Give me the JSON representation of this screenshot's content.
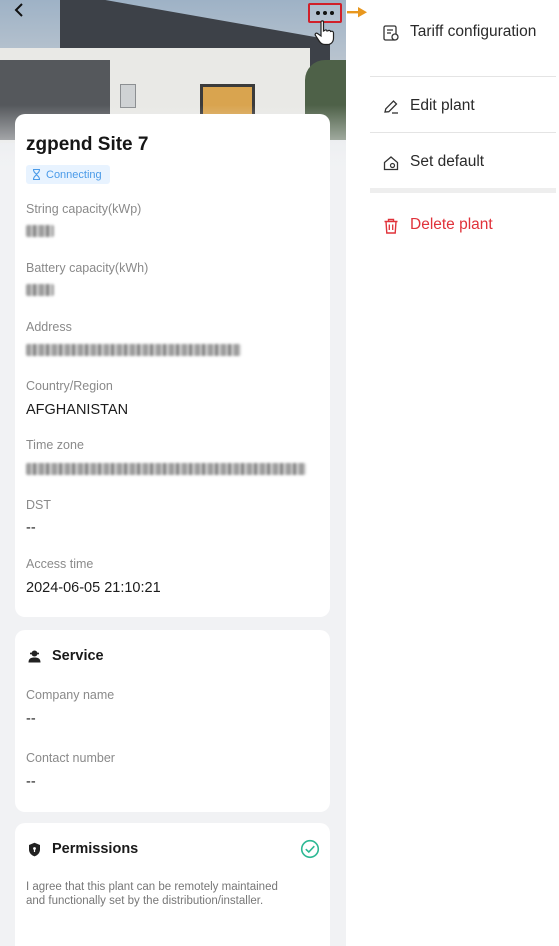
{
  "header": {
    "back_icon": "chevron-left-icon",
    "more_icon": "more-horizontal-icon"
  },
  "plant": {
    "name": "zgpend Site 7",
    "status": "Connecting",
    "fields": [
      {
        "label": "String capacity(kWp)",
        "value": ""
      },
      {
        "label": "Battery capacity(kWh)",
        "value": ""
      },
      {
        "label": "Address",
        "value": ""
      },
      {
        "label": "Country/Region",
        "value": "AFGHANISTAN"
      },
      {
        "label": "Time zone",
        "value": ""
      },
      {
        "label": "DST",
        "value": "--"
      },
      {
        "label": "Access time",
        "value": "2024-06-05 21:10:21"
      }
    ]
  },
  "service": {
    "title": "Service",
    "fields": [
      {
        "label": "Company name",
        "value": "--"
      },
      {
        "label": "Contact number",
        "value": "--"
      }
    ]
  },
  "permissions": {
    "title": "Permissions",
    "text": "I agree that this plant can be remotely maintained and functionally set by the distribution/installer."
  },
  "menu": {
    "items": [
      {
        "label": "Tariff configuration",
        "icon": "tariff-icon"
      },
      {
        "label": "Edit plant",
        "icon": "edit-icon"
      },
      {
        "label": "Set default",
        "icon": "home-icon"
      },
      {
        "label": "Delete plant",
        "icon": "trash-icon"
      }
    ]
  },
  "colors": {
    "highlight_box": "#d0202a",
    "callout_arrow": "#e8971e",
    "danger": "#e0323a",
    "status_text": "#4a9ae8",
    "check": "#2db894"
  }
}
